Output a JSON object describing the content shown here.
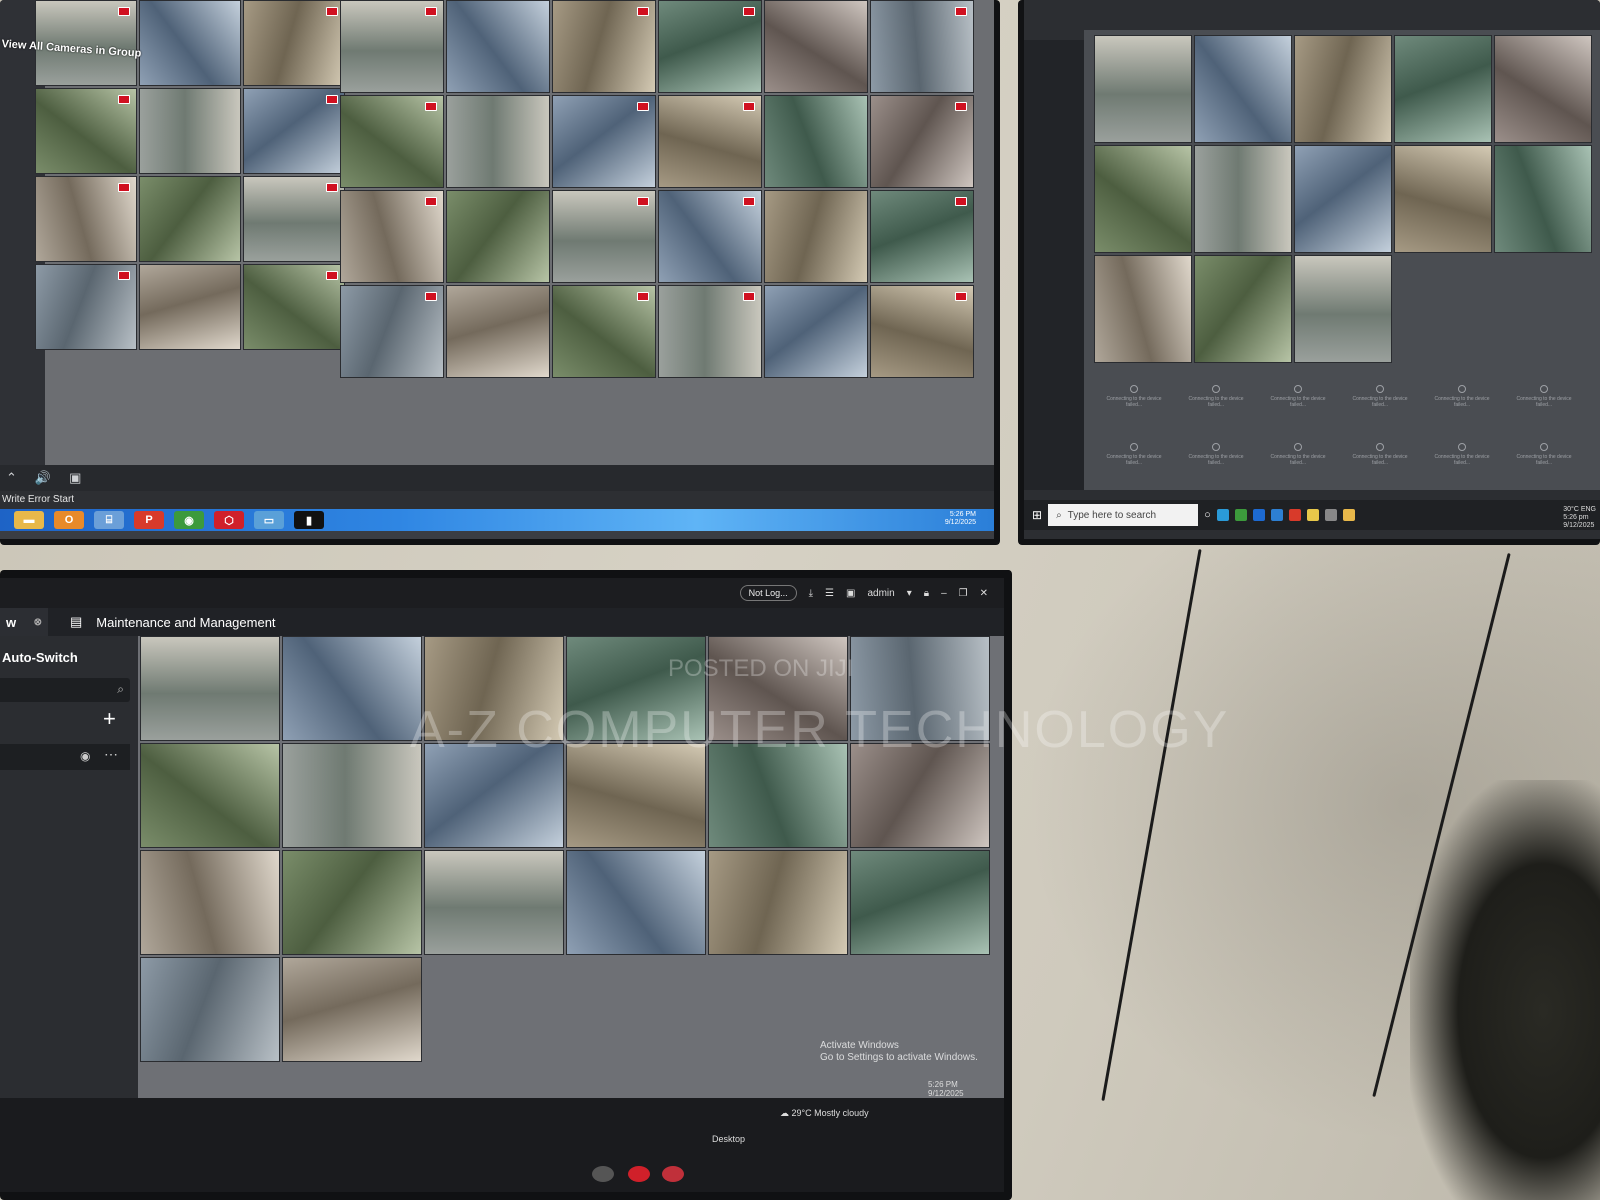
{
  "top_left_monitor": {
    "group_label": "View All Cameras in Group",
    "status_text": "Write Error Start",
    "clock": {
      "time": "5:26 PM",
      "date": "9/12/2025"
    },
    "taskbar_apps": [
      "file-explorer-icon",
      "outlook-icon",
      "network-icon",
      "pdf-icon",
      "chrome-icon",
      "app-icon",
      "remote-icon",
      "terminal-icon"
    ]
  },
  "top_right_monitor": {
    "search_placeholder": "Type here to search",
    "tray": {
      "temp": "30°C",
      "lang": "ENG",
      "time": "5:26 pm",
      "date": "9/12/2025"
    },
    "offline_message": "Connecting to the device failed..."
  },
  "bottom_left_monitor": {
    "title_status": "Not Log...",
    "user": "admin",
    "tab_left": "w",
    "tab_title": "Maintenance and Management",
    "sidebar_title": "Auto-Switch",
    "activate_line1": "Activate Windows",
    "activate_line2": "Go to Settings to activate Windows.",
    "weather_temp": "29°C",
    "weather_text": "Mostly cloudy",
    "desktop_label": "Desktop",
    "clock": {
      "time": "5:26 PM",
      "date": "9/12/2025"
    }
  },
  "watermark": {
    "line1": "POSTED ON JIJI",
    "line2": "A-Z COMPUTER TECHNOLOGY"
  },
  "colors": {
    "recording_indicator": "#d01020",
    "win7_taskbar": "#2f86e3",
    "client_dark": "#2b2d31"
  }
}
